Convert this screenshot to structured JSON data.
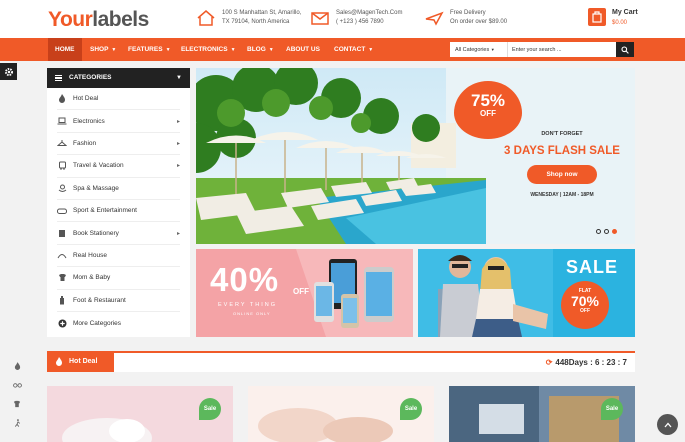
{
  "header": {
    "logo_part1": "Your",
    "logo_part2": "labels",
    "address_line1": "100 S Manhattan St, Amarillo,",
    "address_line2": "TX 79104, North America",
    "email": "Sales@MagenTech.Com",
    "phone": "( +123 ) 456 7890",
    "delivery_title": "Free Delivery",
    "delivery_sub": "On order over $89.00",
    "cart_title": "My Cart",
    "cart_total": "$0.00"
  },
  "nav": {
    "items": [
      {
        "label": "Home"
      },
      {
        "label": "Shop"
      },
      {
        "label": "Features"
      },
      {
        "label": "Electronics"
      },
      {
        "label": "Blog"
      },
      {
        "label": "About Us"
      },
      {
        "label": "Contact"
      }
    ],
    "search_category": "All Categories",
    "search_placeholder": "Enter your search ..."
  },
  "categories": {
    "title": "CATEGORIES",
    "items": [
      {
        "label": "Hot Deal",
        "icon": "flame-icon"
      },
      {
        "label": "Electronics",
        "icon": "laptop-icon"
      },
      {
        "label": "Fashion",
        "icon": "hanger-icon"
      },
      {
        "label": "Travel & Vacation",
        "icon": "bus-icon"
      },
      {
        "label": "Spa & Massage",
        "icon": "flower-icon"
      },
      {
        "label": "Sport & Entertainment",
        "icon": "gamepad-icon"
      },
      {
        "label": "Book Stationery",
        "icon": "book-icon"
      },
      {
        "label": "Real House",
        "icon": "house-icon"
      },
      {
        "label": "Mom & Baby",
        "icon": "shirt-icon"
      },
      {
        "label": "Foot & Restaurant",
        "icon": "cup-icon"
      },
      {
        "label": "More Categories",
        "icon": "plus-circle-icon"
      }
    ]
  },
  "slider": {
    "badge_pct": "75%",
    "badge_off": "OFF",
    "dont_forget": "DON'T FORGET",
    "headline": "3 DAYS FLASH SALE",
    "button": "Shop now",
    "time": "WENESDAY  |  12AM - 18PM"
  },
  "banner1": {
    "big": "40%",
    "off": "OFF",
    "every": "EVERY THING",
    "only": "ONLINE ONLY"
  },
  "banner2": {
    "sale": "SALE",
    "flat": "FLAT",
    "pct": "70%",
    "off": "OFF"
  },
  "hot_deal": {
    "title": "Hot Deal",
    "countdown": "448Days : 6 : 23 : 7"
  },
  "products": [
    {
      "badge": "Sale"
    },
    {
      "badge": "Sale"
    },
    {
      "badge": "Sale"
    }
  ],
  "colors": {
    "accent": "#f05a28",
    "dark": "#222222"
  }
}
